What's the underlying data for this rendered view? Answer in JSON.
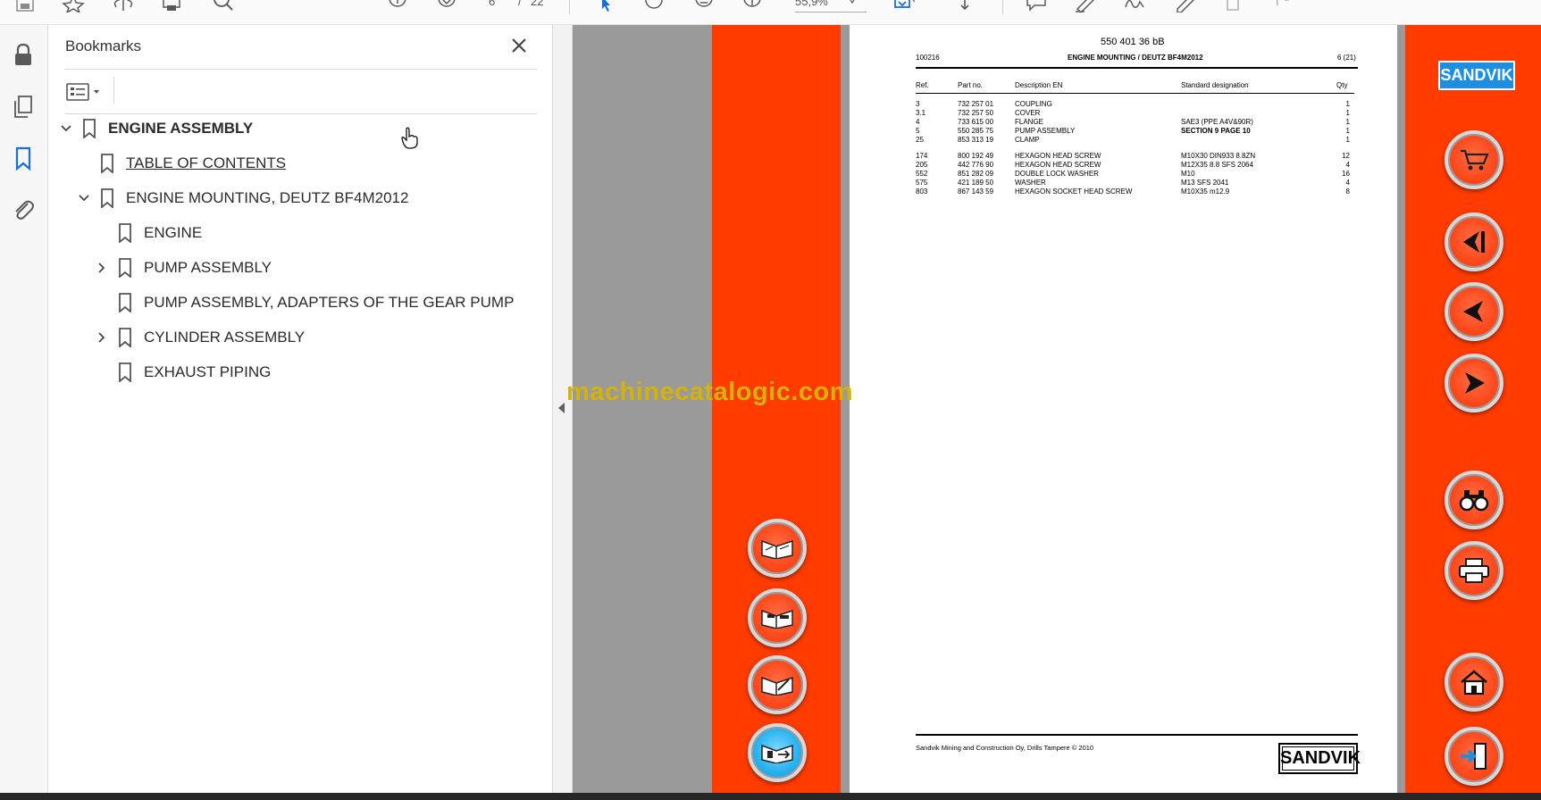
{
  "toolbar": {
    "page_current": "6",
    "page_sep": "/",
    "page_total": "22",
    "zoom": "55,9%"
  },
  "left_rail": {
    "icons": [
      "lock-icon",
      "pages-icon",
      "bookmark-icon",
      "attachment-icon"
    ]
  },
  "bookmarks_panel": {
    "title": "Bookmarks",
    "items": [
      {
        "label": "ENGINE ASSEMBLY",
        "level": 0,
        "expander": "expanded"
      },
      {
        "label": "TABLE OF CONTENTS",
        "level": 1,
        "expander": "none"
      },
      {
        "label": "ENGINE MOUNTING, DEUTZ BF4M2012",
        "level": 1,
        "expander": "expanded"
      },
      {
        "label": "ENGINE",
        "level": 2,
        "expander": "none"
      },
      {
        "label": "PUMP ASSEMBLY",
        "level": 2,
        "expander": "collapsed"
      },
      {
        "label": "PUMP ASSEMBLY, ADAPTERS OF THE GEAR PUMP",
        "level": 2,
        "expander": "none"
      },
      {
        "label": "CYLINDER ASSEMBLY",
        "level": 2,
        "expander": "collapsed"
      },
      {
        "label": "EXHAUST PIPING",
        "level": 2,
        "expander": "none"
      }
    ]
  },
  "watermark": "machinecatalogic.com",
  "document": {
    "doc_number": "550 401 36 bB",
    "code": "100216",
    "heading": "ENGINE MOUNTING / DEUTZ BF4M2012",
    "page_ref": "6 (21)",
    "columns": [
      "Ref.",
      "Part no.",
      "Description EN",
      "Standard designation",
      "Qty"
    ],
    "rows": [
      {
        "ref": "3",
        "part": "732 257 01",
        "desc": "COUPLING",
        "std": "",
        "qty": "1",
        "group": 1
      },
      {
        "ref": "3.1",
        "part": "732 257 50",
        "desc": "COVER",
        "std": "",
        "qty": "1",
        "group": 1
      },
      {
        "ref": "4",
        "part": "733 615 00",
        "desc": "FLANGE",
        "std": "SAE3 (PPE A4V&90R)",
        "qty": "1",
        "group": 1
      },
      {
        "ref": "5",
        "part": "550 285 75",
        "desc": "PUMP ASSEMBLY",
        "std": "SECTION 9 PAGE 10",
        "qty": "1",
        "group": 1,
        "std_bold": true
      },
      {
        "ref": "25",
        "part": "853 313 19",
        "desc": "CLAMP",
        "std": "",
        "qty": "1",
        "group": 1
      },
      {
        "ref": "174",
        "part": "800 192 49",
        "desc": "HEXAGON HEAD SCREW",
        "std": "M10X30 DIN933 8.8ZN",
        "qty": "12",
        "group": 2
      },
      {
        "ref": "205",
        "part": "442 776 90",
        "desc": "HEXAGON HEAD SCREW",
        "std": "M12X35 8.8 SFS 2064",
        "qty": "4",
        "group": 2
      },
      {
        "ref": "552",
        "part": "851 282 09",
        "desc": "DOUBLE LOCK WASHER",
        "std": "M10",
        "qty": "16",
        "group": 2
      },
      {
        "ref": "575",
        "part": "421 189 50",
        "desc": "WASHER",
        "std": "M13 SFS 2041",
        "qty": "4",
        "group": 2
      },
      {
        "ref": "803",
        "part": "867 143 59",
        "desc": "HEXAGON SOCKET HEAD SCREW",
        "std": "M10X35 m12.9",
        "qty": "8",
        "group": 2
      }
    ],
    "footer_text": "Sandvik Mining and Construction Oy, Drills Tampere © 2010",
    "footer_logo": "SANDVIK"
  },
  "right_panel": {
    "logo": "SANDVIK"
  },
  "colors": {
    "accent_red": "#ff3b00",
    "sandvik_blue": "#1e8ee3",
    "watermark": "#d4b20a"
  }
}
